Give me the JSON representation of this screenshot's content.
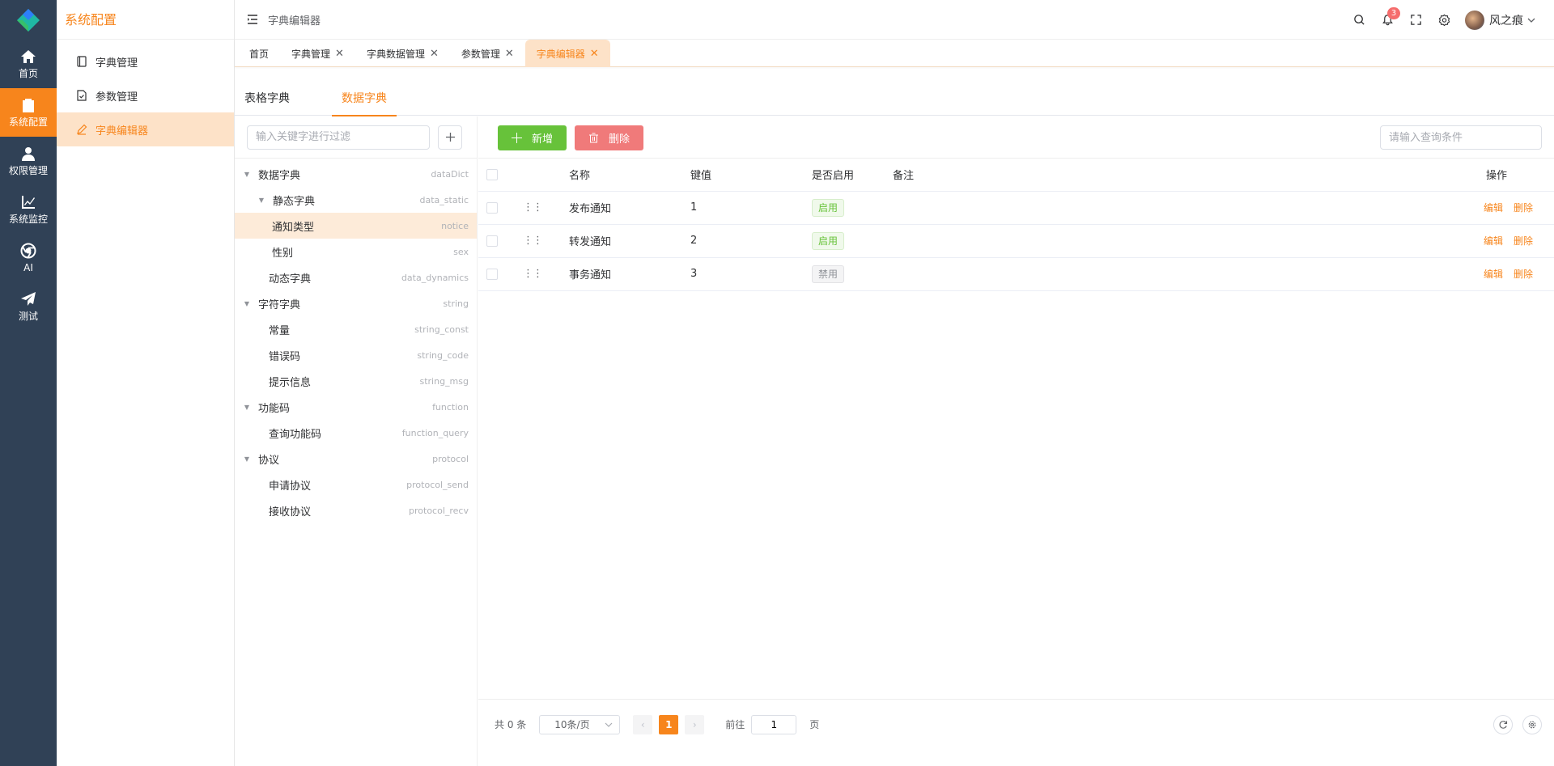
{
  "rail": {
    "items": [
      {
        "label": "首页",
        "icon": "home-icon"
      },
      {
        "label": "系统配置",
        "icon": "clipboard-check-icon"
      },
      {
        "label": "权限管理",
        "icon": "user-icon"
      },
      {
        "label": "系统监控",
        "icon": "chart-line-icon"
      },
      {
        "label": "AI",
        "icon": "chrome-icon"
      },
      {
        "label": "测试",
        "icon": "paper-plane-icon"
      }
    ]
  },
  "submenu": {
    "title": "系统配置",
    "items": [
      {
        "label": "字典管理",
        "icon": "notebook-icon"
      },
      {
        "label": "参数管理",
        "icon": "document-check-icon"
      },
      {
        "label": "字典编辑器",
        "icon": "edit-pen-icon"
      }
    ]
  },
  "header": {
    "breadcrumb": "字典编辑器",
    "notification_count": "3",
    "user_name": "风之痕"
  },
  "tabs": [
    {
      "label": "首页"
    },
    {
      "label": "字典管理"
    },
    {
      "label": "字典数据管理"
    },
    {
      "label": "参数管理"
    },
    {
      "label": "字典编辑器"
    }
  ],
  "dict_tabs": {
    "t1": "表格字典",
    "t2": "数据字典"
  },
  "tree": {
    "filter_placeholder": "输入关键字进行过滤",
    "nodes": [
      {
        "label": "数据字典",
        "key": "dataDict"
      },
      {
        "label": "静态字典",
        "key": "data_static"
      },
      {
        "label": "通知类型",
        "key": "notice"
      },
      {
        "label": "性别",
        "key": "sex"
      },
      {
        "label": "动态字典",
        "key": "data_dynamics"
      },
      {
        "label": "字符字典",
        "key": "string"
      },
      {
        "label": "常量",
        "key": "string_const"
      },
      {
        "label": "错误码",
        "key": "string_code"
      },
      {
        "label": "提示信息",
        "key": "string_msg"
      },
      {
        "label": "功能码",
        "key": "function"
      },
      {
        "label": "查询功能码",
        "key": "function_query"
      },
      {
        "label": "协议",
        "key": "protocol"
      },
      {
        "label": "申请协议",
        "key": "protocol_send"
      },
      {
        "label": "接收协议",
        "key": "protocol_recv"
      }
    ]
  },
  "toolbar": {
    "add_label": "新增",
    "delete_label": "删除",
    "query_placeholder": "请输入查询条件"
  },
  "table": {
    "headers": {
      "name": "名称",
      "key": "键值",
      "enabled": "是否启用",
      "remark": "备注",
      "ops": "操作"
    },
    "rows": [
      {
        "name": "发布通知",
        "key": "1",
        "status": "启用",
        "enabled": true,
        "remark": "",
        "edit": "编辑",
        "del": "删除"
      },
      {
        "name": "转发通知",
        "key": "2",
        "status": "启用",
        "enabled": true,
        "remark": "",
        "edit": "编辑",
        "del": "删除"
      },
      {
        "name": "事务通知",
        "key": "3",
        "status": "禁用",
        "enabled": false,
        "remark": "",
        "edit": "编辑",
        "del": "删除"
      }
    ]
  },
  "pager": {
    "total": "共 0 条",
    "page_size": "10条/页",
    "current_page": "1",
    "goto_label": "前往",
    "goto_value": "1",
    "page_word": "页"
  },
  "colors": {
    "accent": "#f7851c",
    "rail_bg": "#304156",
    "success": "#67c23a",
    "danger": "#f07a7a"
  }
}
